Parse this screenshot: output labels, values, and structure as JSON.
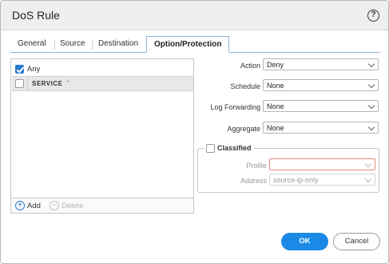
{
  "dialog": {
    "title": "DoS Rule",
    "help_icon": "?"
  },
  "tabs": [
    {
      "label": "General",
      "active": false
    },
    {
      "label": "Source",
      "active": false
    },
    {
      "label": "Destination",
      "active": false
    },
    {
      "label": "Option/Protection",
      "active": true
    }
  ],
  "service_panel": {
    "any_label": "Any",
    "any_checked": true,
    "column_header": "SERVICE",
    "rows": [],
    "add_label": "Add",
    "delete_label": "Delete"
  },
  "fields": {
    "action": {
      "label": "Action",
      "value": "Deny"
    },
    "schedule": {
      "label": "Schedule",
      "value": "None"
    },
    "log_forwarding": {
      "label": "Log Forwarding",
      "value": "None"
    },
    "aggregate": {
      "label": "Aggregate",
      "value": "None"
    }
  },
  "classified": {
    "label": "Classified",
    "checked": false,
    "profile": {
      "label": "Profile",
      "value": ""
    },
    "address": {
      "label": "Address",
      "value": "source-ip-only"
    }
  },
  "buttons": {
    "ok": "OK",
    "cancel": "Cancel"
  },
  "colors": {
    "accent": "#1a8ae6",
    "tab_border": "#8fb5d9",
    "invalid_border": "#e08a79"
  }
}
